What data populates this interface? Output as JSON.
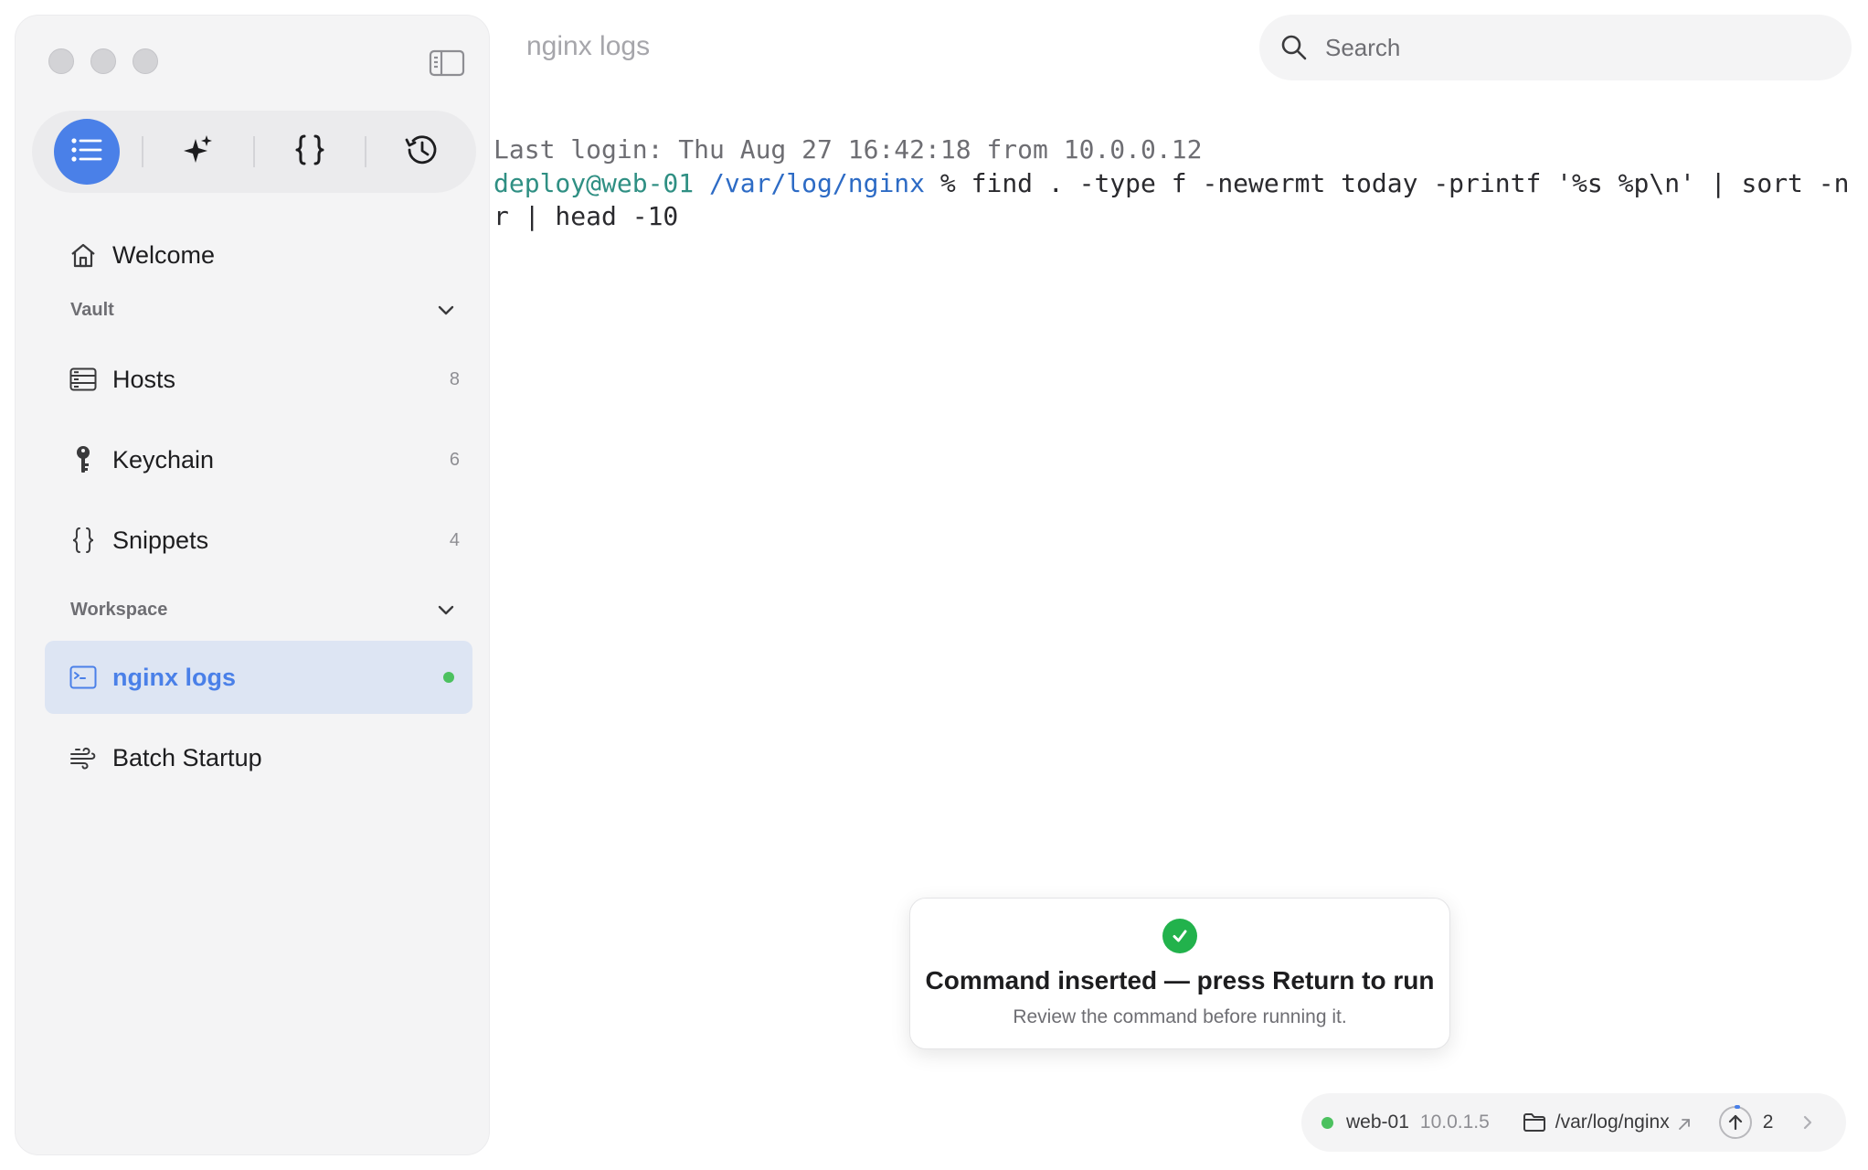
{
  "window": {
    "title": "nginx logs"
  },
  "search": {
    "placeholder": "Search"
  },
  "sidebar": {
    "welcome_label": "Welcome",
    "sections": {
      "vault": "Vault",
      "workspace": "Workspace"
    },
    "vault_items": [
      {
        "label": "Hosts",
        "count": "8",
        "icon": "server-icon"
      },
      {
        "label": "Keychain",
        "count": "6",
        "icon": "key-icon"
      },
      {
        "label": "Snippets",
        "count": "4",
        "icon": "braces-icon"
      }
    ],
    "workspace_items": [
      {
        "label": "nginx logs",
        "icon": "terminal-icon",
        "active": true,
        "status": "connected"
      },
      {
        "label": "Batch Startup",
        "icon": "wind-icon",
        "active": false
      }
    ],
    "toolbar": [
      "list-icon",
      "sparkles-icon",
      "braces-icon",
      "history-icon"
    ]
  },
  "terminal": {
    "last_login": "Last login: Thu Aug 27 16:42:18 from 10.0.0.12",
    "prompt_user": "deploy@web-01",
    "prompt_path": "/var/log/nginx",
    "command_line1": " % find . -type f -newermt today -printf '%s %p\\n' | sort -n",
    "command_line2": "r | head -10"
  },
  "toast": {
    "title": "Command inserted — press Return to run",
    "subtitle": "Review the command before running it."
  },
  "statusbar": {
    "host": "web-01",
    "ip": "10.0.1.5",
    "path": "/var/log/nginx",
    "transfer_count": "2"
  },
  "colors": {
    "accent": "#4a80e8",
    "success": "#22b24c",
    "online": "#4cc15f",
    "prompt_user": "#2f8f83",
    "prompt_path": "#2d6bc5"
  }
}
